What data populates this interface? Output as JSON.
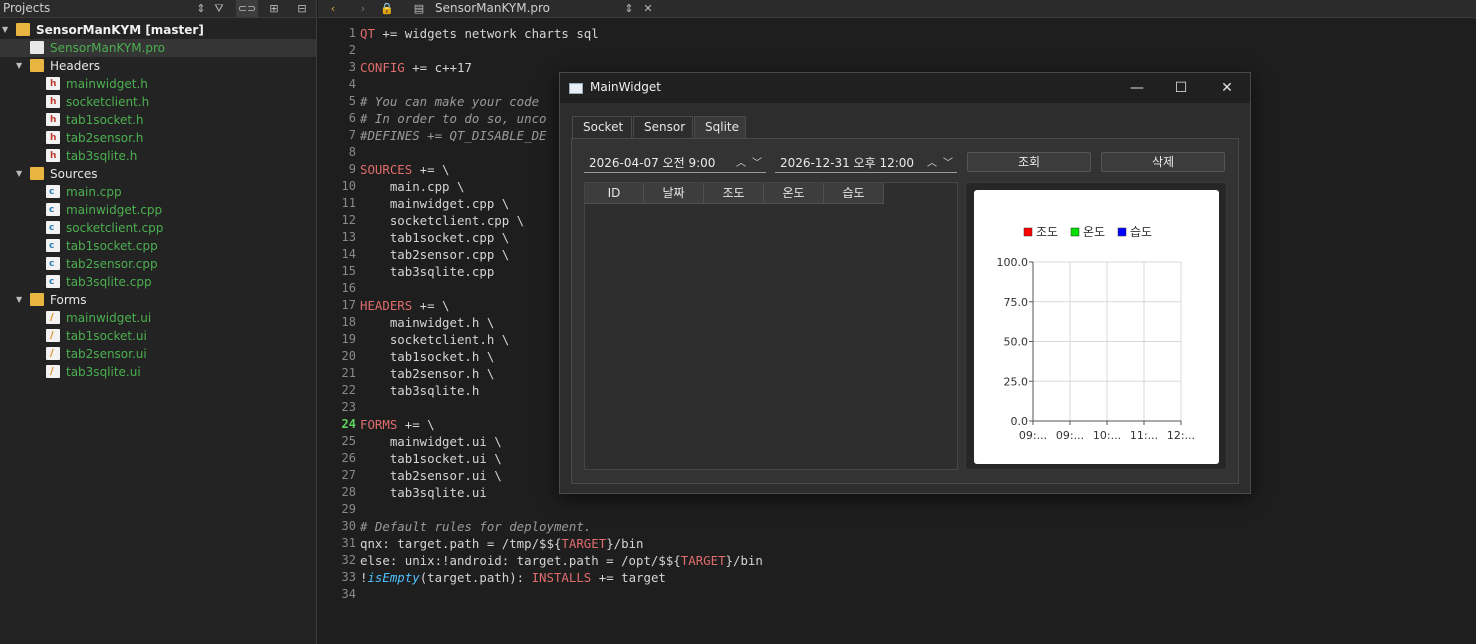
{
  "projects": {
    "title": "Projects",
    "tree": [
      {
        "label": "SensorManKYM [master]",
        "kind": "project",
        "style": "bold"
      },
      {
        "label": "SensorManKYM.pro",
        "kind": "pro",
        "style": "green"
      },
      {
        "label": "Headers",
        "kind": "folder",
        "style": "white"
      },
      {
        "label": "mainwidget.h",
        "kind": "h",
        "style": "green"
      },
      {
        "label": "socketclient.h",
        "kind": "h",
        "style": "green"
      },
      {
        "label": "tab1socket.h",
        "kind": "h",
        "style": "green"
      },
      {
        "label": "tab2sensor.h",
        "kind": "h",
        "style": "green"
      },
      {
        "label": "tab3sqlite.h",
        "kind": "h",
        "style": "green"
      },
      {
        "label": "Sources",
        "kind": "folder",
        "style": "white"
      },
      {
        "label": "main.cpp",
        "kind": "cpp",
        "style": "green"
      },
      {
        "label": "mainwidget.cpp",
        "kind": "cpp",
        "style": "green"
      },
      {
        "label": "socketclient.cpp",
        "kind": "cpp",
        "style": "green"
      },
      {
        "label": "tab1socket.cpp",
        "kind": "cpp",
        "style": "green"
      },
      {
        "label": "tab2sensor.cpp",
        "kind": "cpp",
        "style": "green"
      },
      {
        "label": "tab3sqlite.cpp",
        "kind": "cpp",
        "style": "green"
      },
      {
        "label": "Forms",
        "kind": "folder",
        "style": "white"
      },
      {
        "label": "mainwidget.ui",
        "kind": "ui",
        "style": "green"
      },
      {
        "label": "tab1socket.ui",
        "kind": "ui",
        "style": "green"
      },
      {
        "label": "tab2sensor.ui",
        "kind": "ui",
        "style": "green"
      },
      {
        "label": "tab3sqlite.ui",
        "kind": "ui",
        "style": "green"
      }
    ]
  },
  "editor": {
    "open_file": "SensorManKYM.pro",
    "current_line": 24,
    "lines": [
      "QT += widgets network charts sql",
      "",
      "CONFIG += c++17",
      "",
      "# You can make your code",
      "# In order to do so, unco",
      "#DEFINES += QT_DISABLE_DE",
      "",
      "SOURCES += \\",
      "    main.cpp \\",
      "    mainwidget.cpp \\",
      "    socketclient.cpp \\",
      "    tab1socket.cpp \\",
      "    tab2sensor.cpp \\",
      "    tab3sqlite.cpp",
      "",
      "HEADERS += \\",
      "    mainwidget.h \\",
      "    socketclient.h \\",
      "    tab1socket.h \\",
      "    tab2sensor.h \\",
      "    tab3sqlite.h",
      "",
      "FORMS += \\",
      "    mainwidget.ui \\",
      "    tab1socket.ui \\",
      "    tab2sensor.ui \\",
      "    tab3sqlite.ui",
      "",
      "# Default rules for deployment.",
      "qnx: target.path = /tmp/$${TARGET}/bin",
      "else: unix:!android: target.path = /opt/$${TARGET}/bin",
      "!isEmpty(target.path): INSTALLS += target",
      ""
    ]
  },
  "window": {
    "title": "MainWidget",
    "minimize": "—",
    "maximize": "☐",
    "close": "✕",
    "tabs": [
      "Socket",
      "Sensor",
      "Sqlite"
    ],
    "active_tab": "Sqlite",
    "date_from": "2026-04-07 오전 9:00",
    "date_to": "2026-12-31 오후 12:00",
    "query_button": "조회",
    "delete_button": "삭제",
    "table_headers": [
      "ID",
      "날짜",
      "조도",
      "온도",
      "습도"
    ]
  },
  "chart_data": {
    "type": "line",
    "series": [
      {
        "name": "조도",
        "color": "#ff0000",
        "values": []
      },
      {
        "name": "온도",
        "color": "#00e000",
        "values": []
      },
      {
        "name": "습도",
        "color": "#0000ff",
        "values": []
      }
    ],
    "ylim": [
      0,
      100
    ],
    "yticks": [
      "0.0",
      "25.0",
      "50.0",
      "75.0",
      "100.0"
    ],
    "xticks": [
      "09:...",
      "09:...",
      "10:...",
      "11:...",
      "12:..."
    ],
    "legend": "top",
    "grid": true
  }
}
